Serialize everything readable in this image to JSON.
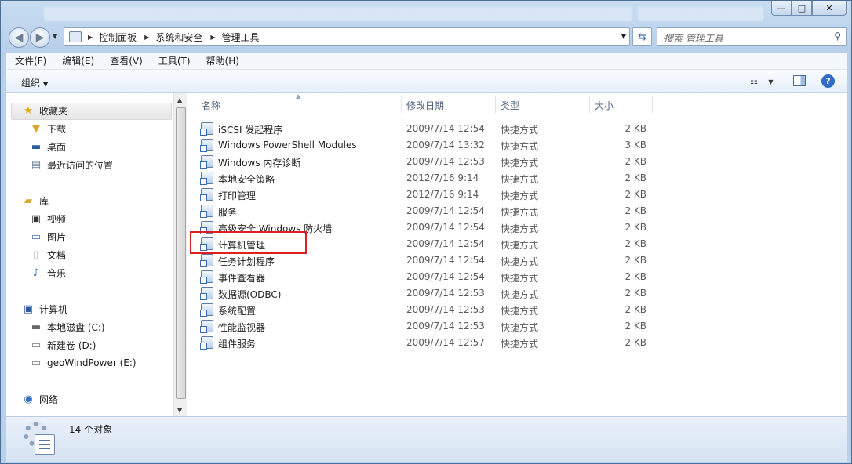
{
  "window": {
    "address": {
      "crumbs": [
        "控制面板",
        "系统和安全",
        "管理工具"
      ]
    },
    "search_placeholder": "搜索 管理工具",
    "caption": {
      "minimize": "—",
      "maximize": "□",
      "close": "✕"
    }
  },
  "menu": [
    "文件(F)",
    "编辑(E)",
    "查看(V)",
    "工具(T)",
    "帮助(H)"
  ],
  "toolbar": {
    "organize": "组织",
    "help": "?"
  },
  "sidebar": {
    "favorites": {
      "label": "收藏夹",
      "items": [
        "下载",
        "桌面",
        "最近访问的位置"
      ]
    },
    "libraries": {
      "label": "库",
      "items": [
        "视频",
        "图片",
        "文档",
        "音乐"
      ]
    },
    "computer": {
      "label": "计算机",
      "items": [
        "本地磁盘 (C:)",
        "新建卷 (D:)",
        "geoWindPower (E:)"
      ]
    },
    "network": {
      "label": "网络"
    }
  },
  "columns": {
    "name": "名称",
    "modified": "修改日期",
    "type": "类型",
    "size": "大小"
  },
  "files": [
    {
      "name": "iSCSI 发起程序",
      "date": "2009/7/14 12:54",
      "type": "快捷方式",
      "size": "2 KB"
    },
    {
      "name": "Windows PowerShell Modules",
      "date": "2009/7/14 13:32",
      "type": "快捷方式",
      "size": "3 KB"
    },
    {
      "name": "Windows 内存诊断",
      "date": "2009/7/14 12:53",
      "type": "快捷方式",
      "size": "2 KB"
    },
    {
      "name": "本地安全策略",
      "date": "2012/7/16 9:14",
      "type": "快捷方式",
      "size": "2 KB"
    },
    {
      "name": "打印管理",
      "date": "2012/7/16 9:14",
      "type": "快捷方式",
      "size": "2 KB"
    },
    {
      "name": "服务",
      "date": "2009/7/14 12:54",
      "type": "快捷方式",
      "size": "2 KB"
    },
    {
      "name": "高级安全 Windows 防火墙",
      "date": "2009/7/14 12:54",
      "type": "快捷方式",
      "size": "2 KB"
    },
    {
      "name": "计算机管理",
      "date": "2009/7/14 12:54",
      "type": "快捷方式",
      "size": "2 KB"
    },
    {
      "name": "任务计划程序",
      "date": "2009/7/14 12:54",
      "type": "快捷方式",
      "size": "2 KB"
    },
    {
      "name": "事件查看器",
      "date": "2009/7/14 12:54",
      "type": "快捷方式",
      "size": "2 KB"
    },
    {
      "name": "数据源(ODBC)",
      "date": "2009/7/14 12:53",
      "type": "快捷方式",
      "size": "2 KB"
    },
    {
      "name": "系统配置",
      "date": "2009/7/14 12:53",
      "type": "快捷方式",
      "size": "2 KB"
    },
    {
      "name": "性能监视器",
      "date": "2009/7/14 12:53",
      "type": "快捷方式",
      "size": "2 KB"
    },
    {
      "name": "组件服务",
      "date": "2009/7/14 12:57",
      "type": "快捷方式",
      "size": "2 KB"
    }
  ],
  "status": {
    "count_text": "14 个对象"
  },
  "colors": {
    "highlight": "#e02020",
    "frame": "#b8d0ea"
  }
}
